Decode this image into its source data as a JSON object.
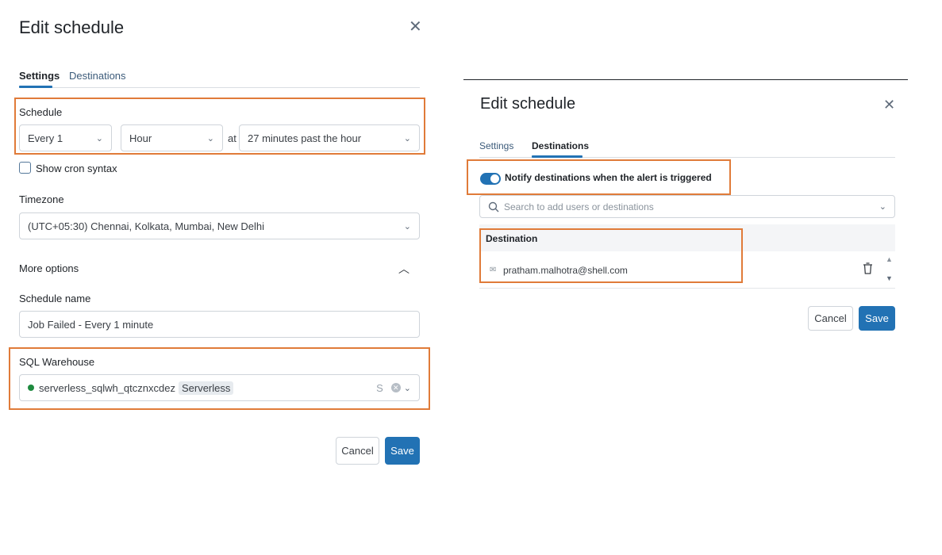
{
  "left": {
    "title": "Edit schedule",
    "tabs": [
      {
        "label": "Settings"
      },
      {
        "label": "Destinations"
      }
    ],
    "schedule": {
      "label": "Schedule",
      "every": "Every 1",
      "unit": "Hour",
      "at": "at",
      "time": "27 minutes past the hour"
    },
    "cron_label": "Show cron syntax",
    "timezone": {
      "label": "Timezone",
      "value": "(UTC+05:30) Chennai, Kolkata, Mumbai, New Delhi"
    },
    "more_options": "More options",
    "schedule_name": {
      "label": "Schedule name",
      "value": "Job Failed - Every 1 minute"
    },
    "warehouse": {
      "label": "SQL Warehouse",
      "name": "serverless_sqlwh_qtcznxcdez",
      "badge": "Serverless",
      "size": "S"
    },
    "cancel": "Cancel",
    "save": "Save"
  },
  "right": {
    "title": "Edit schedule",
    "tabs": [
      {
        "label": "Settings"
      },
      {
        "label": "Destinations"
      }
    ],
    "notify_label": "Notify destinations when the alert is triggered",
    "notify_enabled": true,
    "search_placeholder": "Search to add users or destinations",
    "table_header": "Destination",
    "destinations": [
      {
        "email": "pratham.malhotra@shell.com"
      }
    ],
    "cancel": "Cancel",
    "save": "Save"
  },
  "colors": {
    "accent": "#2272b4",
    "highlight": "#e07b39",
    "status_green": "#1e8a3f"
  },
  "icons": [
    "close-icon",
    "chevron-down-icon",
    "chevron-up-icon",
    "search-icon",
    "mail-icon",
    "trash-icon",
    "clear-icon"
  ]
}
